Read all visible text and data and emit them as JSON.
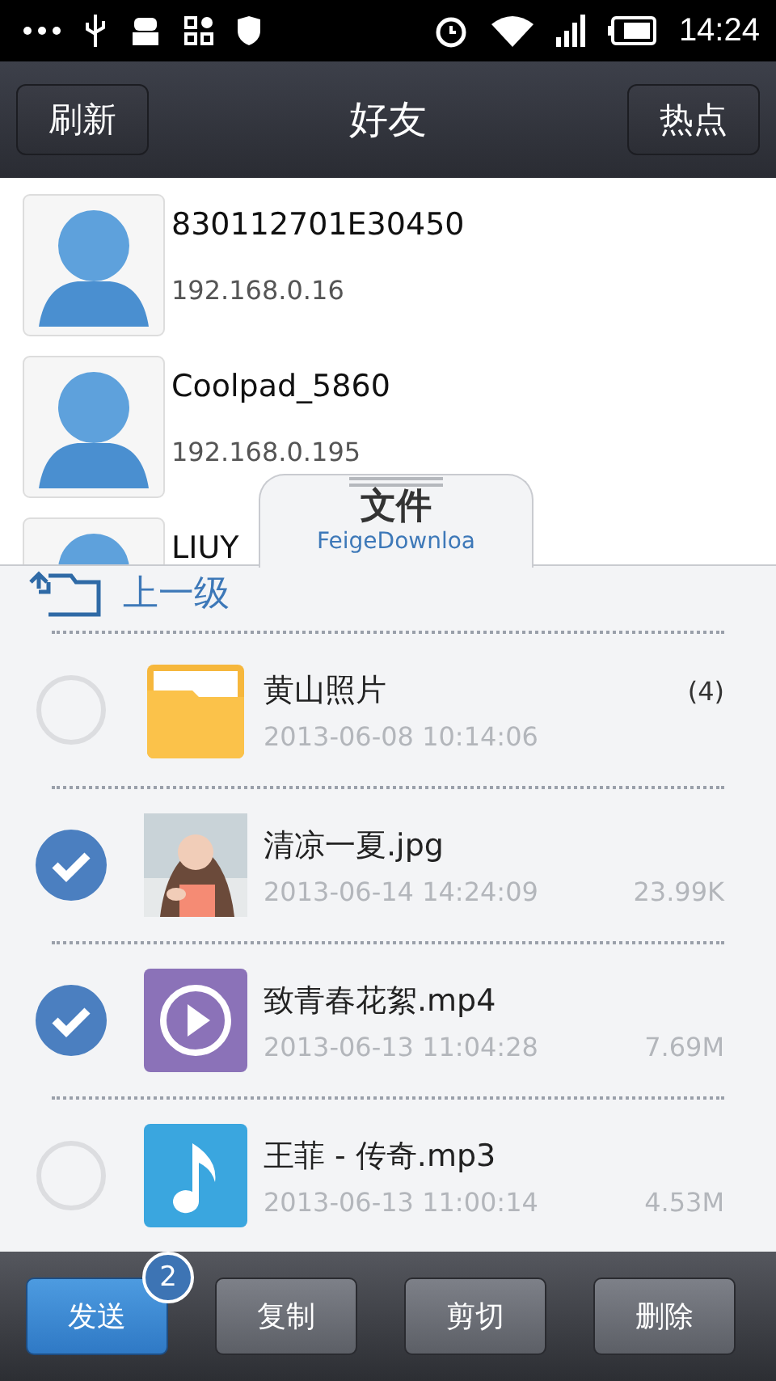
{
  "status_bar": {
    "time": "14:24"
  },
  "header": {
    "title": "好友",
    "left_button": "刷新",
    "right_button": "热点"
  },
  "friends": [
    {
      "name": "830112701E30450",
      "ip": "192.168.0.16"
    },
    {
      "name": "Coolpad_5860",
      "ip": "192.168.0.195"
    },
    {
      "name": "LIUY"
    }
  ],
  "file_panel": {
    "tab_title": "文件",
    "tab_path": "FeigeDownloa",
    "up_label": "上一级",
    "files": [
      {
        "kind": "folder",
        "name": "黄山照片",
        "date": "2013-06-08 10:14:06",
        "meta": "(4)",
        "checked": false
      },
      {
        "name": "清凉一夏.jpg",
        "date": "2013-06-14 14:24:09",
        "meta": "23.99K",
        "checked": true
      },
      {
        "kind": "video",
        "name": "致青春花絮.mp4",
        "date": "2013-06-13 11:04:28",
        "meta": "7.69M",
        "checked": true
      },
      {
        "kind": "audio",
        "name": "王菲 - 传奇.mp3",
        "date": "2013-06-13 11:00:14",
        "meta": "4.53M",
        "checked": false
      }
    ]
  },
  "toolbar": {
    "buttons": [
      {
        "label": "发送",
        "primary": true,
        "badge": "2"
      },
      {
        "label": "复制",
        "primary": false
      },
      {
        "label": "剪切",
        "primary": false
      },
      {
        "label": "删除",
        "primary": false
      }
    ]
  }
}
